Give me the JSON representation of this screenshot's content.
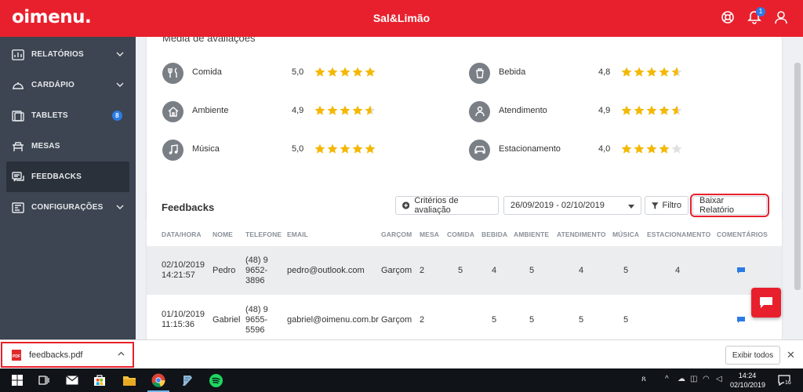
{
  "header": {
    "logo": "oimenu.",
    "title": "Sal&Limão",
    "notification_count": "1"
  },
  "sidebar": {
    "items": [
      {
        "label": "RELATÓRIOS",
        "icon": "chart-icon",
        "has_chevron": true
      },
      {
        "label": "CARDÁPIO",
        "icon": "cloche-icon",
        "has_chevron": true
      },
      {
        "label": "TABLETS",
        "icon": "tablet-icon",
        "badge": "8"
      },
      {
        "label": "MESAS",
        "icon": "table-icon"
      },
      {
        "label": "FEEDBACKS",
        "icon": "feedback-icon",
        "active": true
      },
      {
        "label": "CONFIGURAÇÕES",
        "icon": "settings-icon",
        "has_chevron": true
      }
    ]
  },
  "ratings": {
    "title": "Média de avaliações",
    "items": [
      {
        "label": "Comida",
        "value": "5,0",
        "stars": 5,
        "icon": "cutlery-icon"
      },
      {
        "label": "Bebida",
        "value": "4,8",
        "stars": 4.8,
        "icon": "drink-icon"
      },
      {
        "label": "Ambiente",
        "value": "4,9",
        "stars": 4.9,
        "icon": "home-icon"
      },
      {
        "label": "Atendimento",
        "value": "4,9",
        "stars": 4.9,
        "icon": "waiter-icon"
      },
      {
        "label": "Música",
        "value": "5,0",
        "stars": 5,
        "icon": "music-icon"
      },
      {
        "label": "Estacionamento",
        "value": "4,0",
        "stars": 4,
        "icon": "car-icon"
      }
    ]
  },
  "feedbacks": {
    "title": "Feedbacks",
    "criteria_button": "Critérios de avaliação",
    "date_range": "26/09/2019 - 02/10/2019",
    "filter_button": "Filtro",
    "download_button": "Baixar Relatório",
    "columns": [
      "DATA/HORA",
      "NOME",
      "TELEFONE",
      "EMAIL",
      "GARÇOM",
      "MESA",
      "COMIDA",
      "BEBIDA",
      "AMBIENTE",
      "ATENDIMENTO",
      "MÚSICA",
      "ESTACIONAMENTO",
      "COMENTÁRIOS"
    ],
    "rows": [
      {
        "date": "02/10/2019",
        "time": "14:21:57",
        "name": "Pedro",
        "phone1": "(48) 9",
        "phone2": "9652-",
        "phone3": "3896",
        "email": "pedro@outlook.com",
        "waiter": "Garçom",
        "table": "2",
        "food": "5",
        "drink": "4",
        "ambient": "5",
        "service": "4",
        "music": "5",
        "parking": "4"
      },
      {
        "date": "01/10/2019",
        "time": "11:15:36",
        "name": "Gabriel",
        "phone1": "(48) 9",
        "phone2": "9655-",
        "phone3": "5596",
        "email": "gabriel@oimenu.com.br",
        "waiter": "Garçom",
        "table": "2",
        "food": "",
        "drink": "5",
        "ambient": "5",
        "service": "5",
        "music": "5",
        "parking": ""
      }
    ]
  },
  "download_bar": {
    "filename": "feedbacks.pdf",
    "show_all": "Exibir todos"
  },
  "taskbar": {
    "time": "14:24",
    "date": "02/10/2019",
    "notif_count": "16"
  },
  "colors": {
    "brand": "#e8202d",
    "sidebar": "#3c4551",
    "star": "#f5b800",
    "badge": "#2c7be5"
  }
}
